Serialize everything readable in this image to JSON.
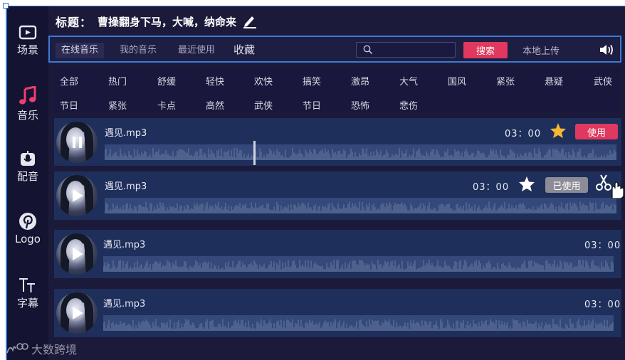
{
  "sidebar": {
    "items": [
      {
        "label": "场景",
        "icon": "tv-icon"
      },
      {
        "label": "音乐",
        "icon": "music-note-icon",
        "active": true
      },
      {
        "label": "配音",
        "icon": "microphone-icon"
      },
      {
        "label": "Logo",
        "icon": "pinterest-icon"
      },
      {
        "label": "字幕",
        "icon": "text-icon"
      }
    ],
    "watermark": "大数跨境"
  },
  "header": {
    "title_label": "标题：",
    "title_value": "曹操翻身下马，大喊，纳命来"
  },
  "tabs": [
    {
      "label": "在线音乐",
      "active": true
    },
    {
      "label": "我的音乐"
    },
    {
      "label": "最近使用"
    },
    {
      "label": "收藏"
    }
  ],
  "search": {
    "placeholder": "",
    "button_label": "搜索"
  },
  "upload_label": "本地上传",
  "categories_row1": [
    "全部",
    "热门",
    "舒缓",
    "轻快",
    "欢快",
    "搞笑",
    "激昂",
    "大气",
    "国风",
    "紧张",
    "悬疑",
    "武侠"
  ],
  "categories_row2": [
    "节日",
    "紧张",
    "卡点",
    "高然",
    "武侠",
    "节日",
    "恐怖",
    "悲伤"
  ],
  "tracks": [
    {
      "name": "遇见.mp3",
      "duration": "03：00",
      "state": "playing",
      "button": "使用",
      "starred": true,
      "progress": 0.29
    },
    {
      "name": "遇见.mp3",
      "duration": "03：00",
      "state": "paused",
      "button": "已使用",
      "starred": false
    },
    {
      "name": "遇见.mp3",
      "duration": "03：00",
      "state": "paused"
    },
    {
      "name": "遇见.mp3",
      "duration": "03：00",
      "state": "paused"
    }
  ],
  "colors": {
    "accent": "#e0385e",
    "panel": "#1e2f5c",
    "bg": "#1b1a3a",
    "star": "#f5b731",
    "selection": "#3b7bd8"
  }
}
